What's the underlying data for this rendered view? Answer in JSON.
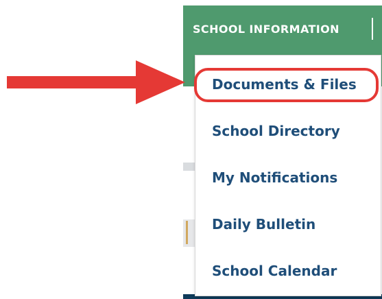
{
  "nav": {
    "label": "SCHOOL INFORMATION"
  },
  "dropdown": {
    "items": [
      {
        "label": "Documents & Files"
      },
      {
        "label": "School Directory"
      },
      {
        "label": "My Notifications"
      },
      {
        "label": "Daily Bulletin"
      },
      {
        "label": "School Calendar"
      }
    ]
  },
  "colors": {
    "nav_green": "#4f9a6e",
    "menu_text": "#1f4e79",
    "highlight_red": "#e53935"
  },
  "icons": {
    "arrow": "right-arrow-icon"
  }
}
